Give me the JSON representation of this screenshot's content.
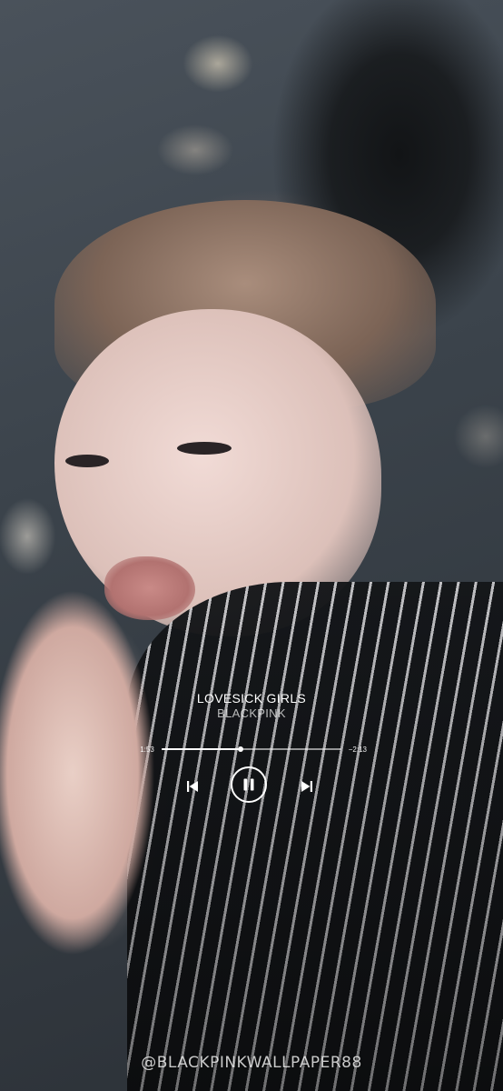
{
  "player": {
    "title": "LOVESICK GIRLS",
    "artist": "BLACKPINK",
    "elapsed": "1:53",
    "remaining": "−2:13",
    "progress": 0.44
  },
  "icons": {
    "previous": "skip-previous-icon",
    "pause": "pause-icon",
    "next": "skip-next-icon"
  },
  "watermark": "@BLACKPINKWALLPAPER88",
  "colors": {
    "overlay_text": "#ffffff",
    "jacket_dark": "#15171a",
    "jacket_stripe": "#cfcfd2"
  }
}
